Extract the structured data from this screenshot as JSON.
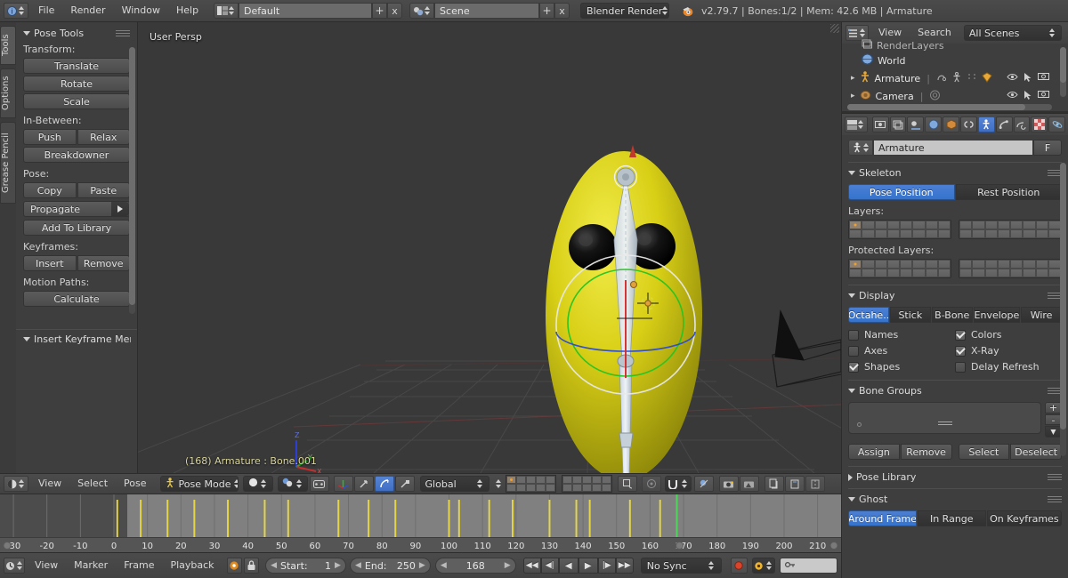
{
  "topbar": {
    "editor_icon": "info-editor-icon",
    "menus": [
      "File",
      "Render",
      "Window",
      "Help"
    ],
    "screen_layout": {
      "icon": "screen-layout-icon",
      "value": "Default",
      "add": "+",
      "remove": "x"
    },
    "scene": {
      "icon": "scene-icon",
      "value": "Scene",
      "add": "+",
      "remove": "x"
    },
    "engine": "Blender Render",
    "blender_icon": "blender-logo-icon",
    "status": "v2.79.7 | Bones:1/2  | Mem: 42.6 MB | Armature"
  },
  "toolshelf": {
    "vertical_tabs": [
      "Tools",
      "Options",
      "Grease Pencil"
    ],
    "active_vertical_tab": "Tools",
    "panels": [
      {
        "title": "Pose Tools",
        "open": true,
        "groups": [
          {
            "label": "Transform:",
            "rows": [
              [
                "Translate"
              ],
              [
                "Rotate"
              ],
              [
                "Scale"
              ]
            ]
          },
          {
            "label": "In-Between:",
            "rows": [
              [
                "Push",
                "Relax"
              ],
              [
                "Breakdowner"
              ]
            ]
          },
          {
            "label": "Pose:",
            "rows": [
              [
                "Copy",
                "Paste"
              ]
            ]
          }
        ],
        "propagate": "Propagate",
        "add_to_library": "Add To Library",
        "keyframes_label": "Keyframes:",
        "keyframe_buttons": [
          "Insert",
          "Remove"
        ],
        "motion_paths_label": "Motion Paths:",
        "motion_paths_buttons": [
          "Calculate"
        ]
      },
      {
        "title": "Insert Keyframe Menu",
        "open": true,
        "groups": []
      }
    ]
  },
  "viewport": {
    "view_name": "User Persp",
    "object_info": "(168) Armature : Bone.001",
    "axis_gizmo": {
      "z": "Z",
      "y": "Y",
      "x": "X"
    },
    "header": {
      "editor_icon": "3d-view-editor-icon",
      "menus": [
        "View",
        "Select",
        "Pose"
      ],
      "mode": "Pose Mode",
      "mode_icon": "pose-mode-icon",
      "shading": "solid-shading-icon",
      "pivot": "pivot-median-point-icon",
      "pivot_extra": "manipulate-center-points-icon",
      "manipulator": "manipulator-icon",
      "transform_translate": "translate-manipulator-icon",
      "transform_rotate": "rotate-manipulator-icon",
      "transform_scale": "scale-manipulator-icon",
      "orientation": "Global",
      "layers_icon": "scene-layers-icon",
      "lock_icon": "lock-icon",
      "proportional_icon": "proportional-edit-icon",
      "snap_icon": "snap-magnet-icon",
      "snap_target_icon": "snap-target-icon",
      "render_icon": "render-icon",
      "render_opengl_icon": "render-opengl-icon",
      "pose_copy_icon": "copy-pose-icon",
      "pose_paste_icon": "paste-pose-icon",
      "pose_paste_flip_icon": "paste-pose-flipped-icon"
    }
  },
  "outliner": {
    "editor_icon": "outliner-editor-icon",
    "menus": [
      "View",
      "Search"
    ],
    "display_mode": "All Scenes",
    "rows": [
      {
        "name": "RenderLayers",
        "icon": "renderlayers-icon",
        "indent": 1,
        "clipped": true
      },
      {
        "name": "World",
        "icon": "world-icon",
        "indent": 1
      },
      {
        "name": "Armature",
        "icon": "armature-icon",
        "indent": 1,
        "expander": true,
        "badges": [
          "pose-icon",
          "armature-data-icon",
          "bone-icon",
          "mesh-data-icon"
        ],
        "restrict": [
          "eye-icon",
          "cursor-select-icon",
          "camera-render-icon"
        ]
      },
      {
        "name": "Camera",
        "icon": "camera-object-icon",
        "indent": 1,
        "expander": true,
        "badges": [
          "camera-data-icon"
        ],
        "restrict": [
          "eye-icon",
          "cursor-select-icon",
          "camera-render-icon"
        ]
      }
    ]
  },
  "properties": {
    "editor_icon": "properties-editor-icon",
    "tabs": [
      {
        "name": "render-tab",
        "icon": "camera-back-icon"
      },
      {
        "name": "render-layers-tab",
        "icon": "renderlayers-icon"
      },
      {
        "name": "scene-tab",
        "icon": "scene-tab-icon"
      },
      {
        "name": "world-tab",
        "icon": "world-tab-icon"
      },
      {
        "name": "object-tab",
        "icon": "object-cube-icon"
      },
      {
        "name": "constraints-tab",
        "icon": "chain-icon"
      },
      {
        "name": "armature-data-tab",
        "icon": "armature-man-icon",
        "active": true
      },
      {
        "name": "bone-tab",
        "icon": "bone-icon"
      },
      {
        "name": "bone-constraint-tab",
        "icon": "bone-constraint-icon"
      },
      {
        "name": "texture-tab",
        "icon": "checker-texture-icon"
      },
      {
        "name": "physics-tab",
        "icon": "physics-icon"
      }
    ],
    "datablock": {
      "icon": "armature-man-icon",
      "value": "Armature",
      "fake_user": "F"
    },
    "panels": {
      "skeleton": {
        "title": "Skeleton",
        "open": true,
        "position_toggle": {
          "options": [
            "Pose Position",
            "Rest Position"
          ],
          "selected": "Pose Position"
        },
        "layers_label": "Layers:",
        "layers_active_index": 0,
        "protected_label": "Protected Layers:",
        "protected_active_index": 0
      },
      "display": {
        "title": "Display",
        "open": true,
        "types": [
          "Octahe..",
          "Stick",
          "B-Bone",
          "Envelope",
          "Wire"
        ],
        "selected_type": "Octahe..",
        "checkboxes": [
          {
            "label": "Names",
            "checked": false
          },
          {
            "label": "Colors",
            "checked": true
          },
          {
            "label": "Axes",
            "checked": false
          },
          {
            "label": "X-Ray",
            "checked": true
          },
          {
            "label": "Shapes",
            "checked": true
          },
          {
            "label": "Delay Refresh",
            "checked": false
          }
        ]
      },
      "bone_groups": {
        "title": "Bone Groups",
        "open": true,
        "list_add": "+",
        "list_remove": "-",
        "list_menu": "specials-menu-icon",
        "buttons": [
          "Assign",
          "Remove",
          "Select",
          "Deselect"
        ]
      },
      "pose_library": {
        "title": "Pose Library",
        "open": false
      },
      "ghost": {
        "title": "Ghost",
        "open": true,
        "modes": [
          "Around Frame",
          "In Range",
          "On Keyframes"
        ],
        "selected_mode": "Around Frame"
      }
    }
  },
  "timeline": {
    "header": {
      "editor_icon": "timeline-editor-icon",
      "menus": [
        "View",
        "Marker",
        "Frame",
        "Playback"
      ],
      "only_selected_icon": "only-selected-channels-icon",
      "lock_icon": "lock-time-icon",
      "start_label": "Start:",
      "start_value": "1",
      "end_label": "End:",
      "end_value": "250",
      "current_frame": "168",
      "transport": [
        "jump-start-icon",
        "prev-keyframe-icon",
        "play-reverse-icon",
        "play-icon",
        "next-keyframe-icon",
        "jump-end-icon"
      ],
      "sync_mode": "No Sync",
      "record_icon": "auto-keyframe-record-icon",
      "keying_set_icon": "keying-set-icon",
      "keying_field": "keying-set-field"
    },
    "ruler_ticks": [
      -30,
      -20,
      -10,
      0,
      10,
      20,
      30,
      40,
      50,
      60,
      70,
      80,
      90,
      100,
      110,
      120,
      130,
      140,
      150,
      160,
      170,
      180,
      190,
      200,
      210
    ],
    "range_start": 1,
    "range_end": 250,
    "playhead_frame": 168,
    "keyframes": [
      1,
      8,
      16,
      24,
      34,
      45,
      52,
      67,
      76,
      84,
      100,
      103,
      112,
      119,
      130,
      138,
      142,
      154,
      163
    ]
  },
  "colors": {
    "accent_blue": "#4b7fd4",
    "keyframe_yellow": "#e3d44a",
    "playhead_green": "#4fd65a",
    "body_yellow": "#d4cc17",
    "info_text": "#d6d6a0",
    "header_bg": "#4b4b4b",
    "panel_bg": "#3e3e3e",
    "viewport_bg": "#393939"
  }
}
